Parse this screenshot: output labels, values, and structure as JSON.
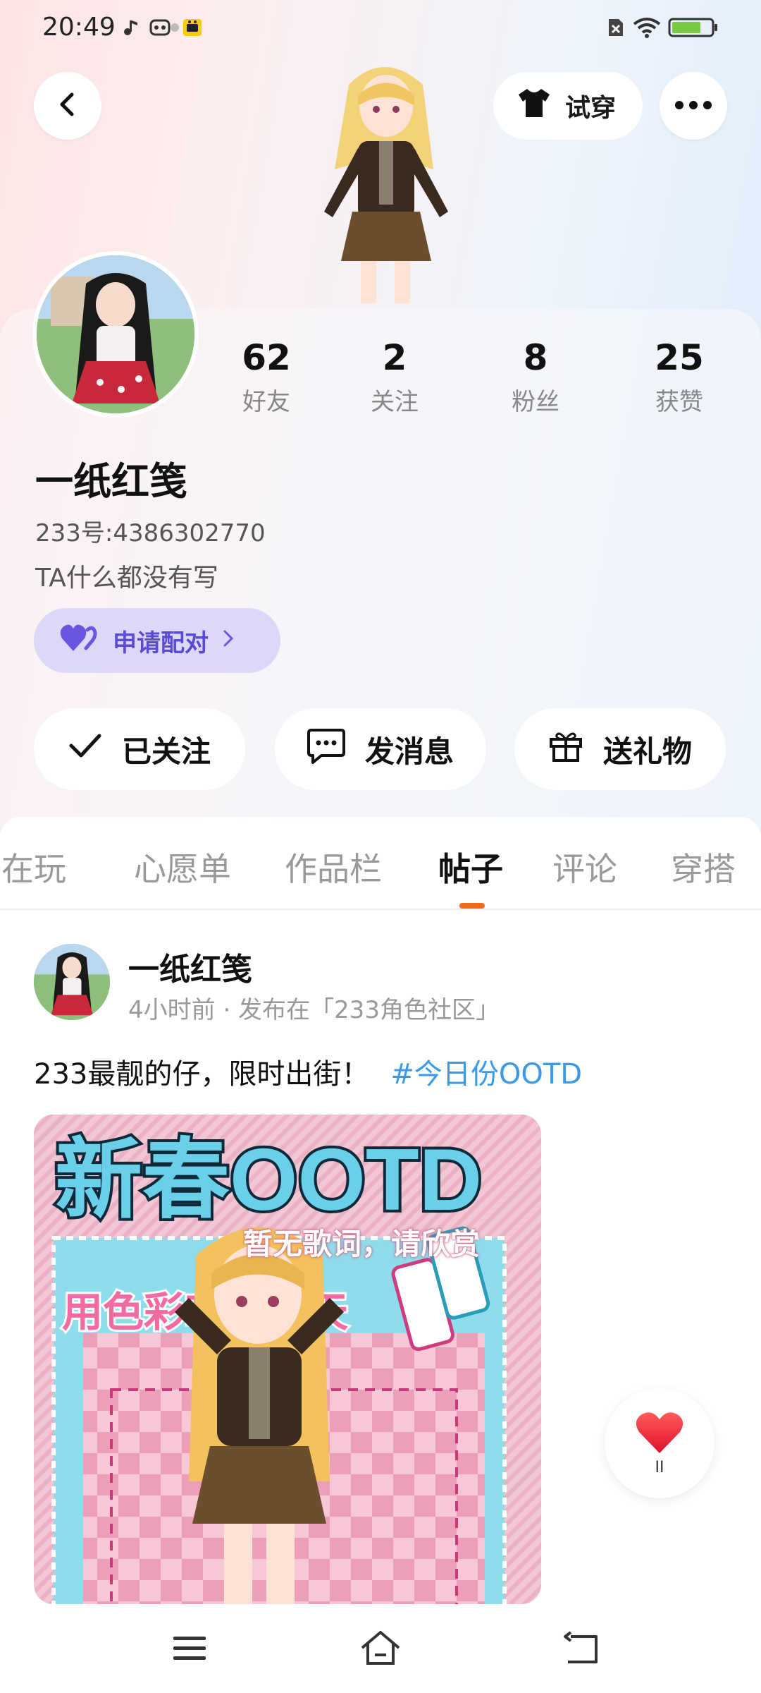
{
  "status_bar": {
    "time": "20:49",
    "icons": [
      "music-note-icon",
      "game-controller-icon",
      "app-notification-icon",
      "no-sim-icon",
      "wifi-icon",
      "battery-icon"
    ]
  },
  "header": {
    "back_icon": "chevron-left-icon",
    "tryon_label": "试穿",
    "more_icon": "more-dots-icon"
  },
  "profile": {
    "stats": [
      {
        "value": "62",
        "label": "好友"
      },
      {
        "value": "2",
        "label": "关注"
      },
      {
        "value": "8",
        "label": "粉丝"
      },
      {
        "value": "25",
        "label": "获赞"
      }
    ],
    "username": "一纸红笺",
    "user_id": "233号:4386302770",
    "bio": "TA什么都没有写",
    "pair_label": "申请配对",
    "actions": [
      {
        "label": "已关注",
        "icon": "check-icon"
      },
      {
        "label": "发消息",
        "icon": "chat-bubble-icon"
      },
      {
        "label": "送礼物",
        "icon": "gift-icon"
      }
    ]
  },
  "tabs": [
    {
      "label": "正在玩",
      "active": false
    },
    {
      "label": "心愿单",
      "active": false
    },
    {
      "label": "作品栏",
      "active": false
    },
    {
      "label": "帖子",
      "active": true
    },
    {
      "label": "评论",
      "active": false
    },
    {
      "label": "穿搭",
      "active": false
    }
  ],
  "post": {
    "author": "一纸红笺",
    "meta": "4小时前 · 发布在「233角色社区」",
    "text": "233最靓的仔，限时出街！",
    "tag": "#今日份OOTD",
    "image": {
      "title": "新春OOTD",
      "subtitle": "用色彩唤醒春天"
    },
    "lyric_overlay": "暂无歌词，请欣赏"
  },
  "floating_like": {
    "icon": "heart-icon",
    "count": "II"
  },
  "colors": {
    "accent_orange": "#f06a1c",
    "pair_purple": "#5a4ad6",
    "tag_blue": "#3a9ae8"
  }
}
